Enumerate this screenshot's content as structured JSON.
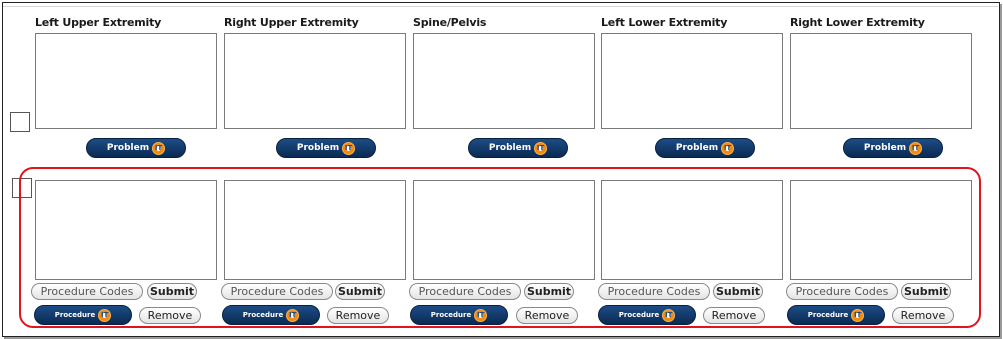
{
  "columns": [
    {
      "title": "Left Upper Extremity"
    },
    {
      "title": "Right Upper Extremity"
    },
    {
      "title": "Spine/Pelvis"
    },
    {
      "title": "Left Lower Extremity"
    },
    {
      "title": "Right Lower Extremity"
    }
  ],
  "buttons": {
    "problem_label": "Problem",
    "procedure_label": "Procedure",
    "badge_text": "IT",
    "procedure_codes_label": "Procedure Codes",
    "submit_label": "Submit",
    "remove_label": "Remove"
  },
  "colors": {
    "pill_blue": "#0f3563",
    "badge_orange": "#f08a10",
    "highlight_red": "#e0141c"
  }
}
